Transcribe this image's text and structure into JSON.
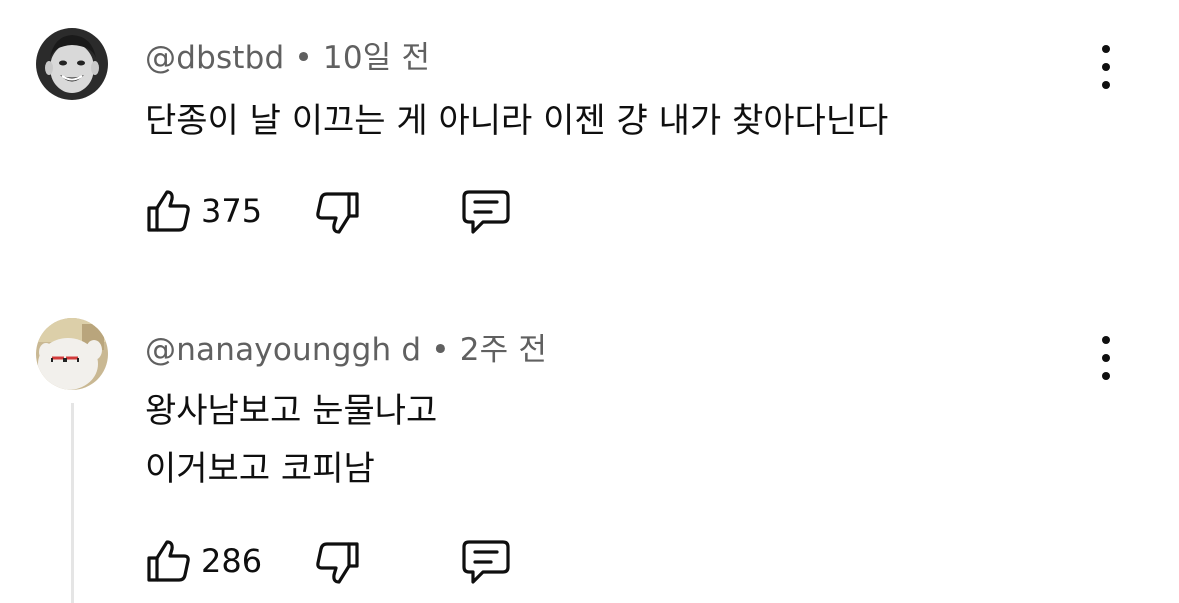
{
  "comments": [
    {
      "author": "@dbstbd",
      "separator": "•",
      "time": "10일 전",
      "lines": [
        "단종이 날 이끄는 게 아니라 이젠 걍 내가 찾아다닌다"
      ],
      "likes": "375",
      "icons": {
        "like": "thumbs-up-icon",
        "dislike": "thumbs-down-icon",
        "reply": "reply-comment-icon",
        "more": "more-vertical-icon"
      }
    },
    {
      "author": "@nanayounggh d",
      "separator": "•",
      "time": "2주 전",
      "lines": [
        "왕사남보고 눈물나고",
        "이거보고 코피남"
      ],
      "likes": "286",
      "icons": {
        "like": "thumbs-up-icon",
        "dislike": "thumbs-down-icon",
        "reply": "reply-comment-icon",
        "more": "more-vertical-icon"
      }
    }
  ],
  "colors": {
    "text": "#0f0f0f",
    "meta": "#606060",
    "thread_line": "#e5e5e5"
  }
}
